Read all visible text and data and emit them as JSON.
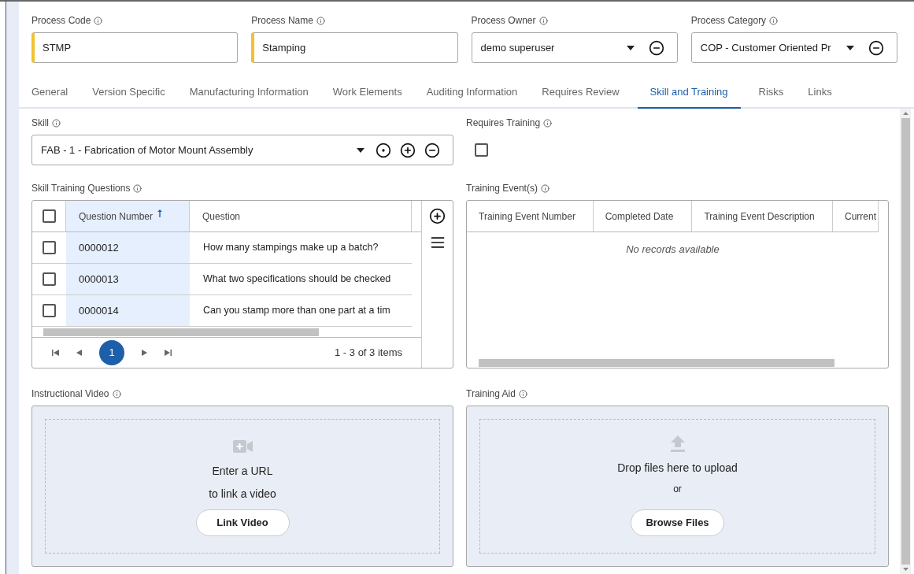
{
  "header_fields": [
    {
      "kind": "text",
      "label": "Process Code",
      "value": "STMP",
      "required": true
    },
    {
      "kind": "text",
      "label": "Process Name",
      "value": "Stamping",
      "required": true
    },
    {
      "kind": "select",
      "label": "Process Owner",
      "value": "demo superuser"
    },
    {
      "kind": "select",
      "label": "Process Category",
      "value": "COP - Customer Oriented Pr"
    }
  ],
  "tabs": [
    {
      "label": "General",
      "selected": false
    },
    {
      "label": "Version Specific",
      "selected": false
    },
    {
      "label": "Manufacturing Information",
      "selected": false
    },
    {
      "label": "Work Elements",
      "selected": false
    },
    {
      "label": "Auditing Information",
      "selected": false
    },
    {
      "label": "Requires Review",
      "selected": false
    },
    {
      "label": "Skill and Training",
      "selected": true
    },
    {
      "label": "Risks",
      "selected": false
    },
    {
      "label": "Links",
      "selected": false
    }
  ],
  "skill": {
    "label": "Skill",
    "value": "FAB - 1 - Fabrication of Motor Mount Assembly"
  },
  "requires_training": {
    "label": "Requires Training",
    "checked": false
  },
  "questions": {
    "label": "Skill Training Questions",
    "header_checked": false,
    "columns": [
      {
        "label": "Question Number",
        "sorted": true
      },
      {
        "label": "Question",
        "sorted": false
      }
    ],
    "rows": [
      {
        "checked": false,
        "number": "0000012",
        "question": "How many stampings make up a batch?"
      },
      {
        "checked": false,
        "number": "0000013",
        "question": "What two specifications should be checked"
      },
      {
        "checked": false,
        "number": "0000014",
        "question": "Can you stamp more than one part at a tim"
      }
    ],
    "pages": [
      {
        "label": "1",
        "selected": true
      }
    ],
    "summary": "1 - 3 of 3 items"
  },
  "events": {
    "label": "Training Event(s)",
    "columns": [
      "Training Event Number",
      "Completed Date",
      "Training Event Description",
      "Current"
    ],
    "empty": "No records available"
  },
  "video": {
    "label": "Instructional Video",
    "lines": [
      "Enter a URL",
      "to link a video"
    ],
    "button": "Link Video"
  },
  "aid": {
    "label": "Training Aid",
    "text": "Drop files here to upload",
    "or": "or",
    "button": "Browse Files"
  }
}
